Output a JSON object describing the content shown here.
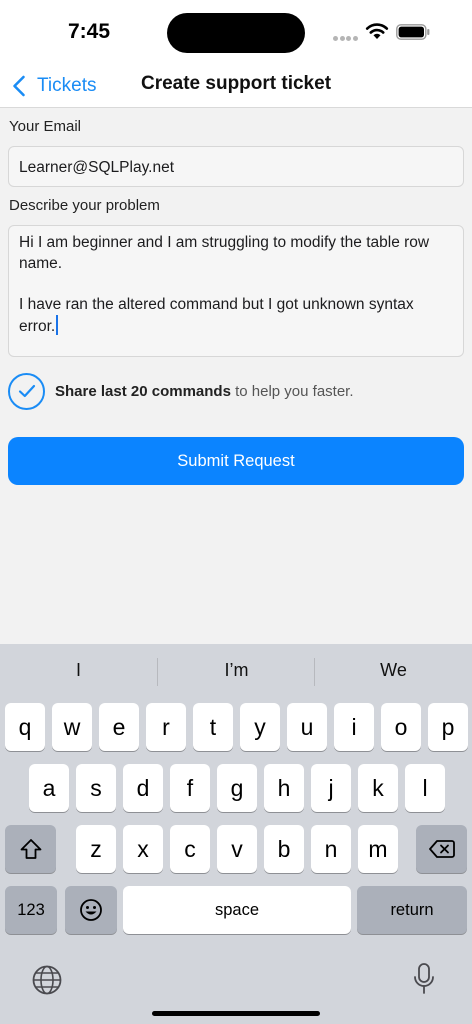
{
  "status_bar": {
    "time": "7:45"
  },
  "nav": {
    "back_label": "Tickets",
    "title": "Create support ticket"
  },
  "form": {
    "email_label": "Your Email",
    "email_value": "Learner@SQLPlay.net",
    "problem_label": "Describe your problem",
    "problem_paragraph_1": "Hi I am beginner and I am struggling to modify the table row name.",
    "problem_paragraph_2": "I have ran the altered command but I got unknown syntax error.",
    "share_bold": "Share last 20 commands",
    "share_rest": " to help you faster.",
    "share_checked": true,
    "submit_label": "Submit Request"
  },
  "keyboard": {
    "suggestions": [
      "I",
      "I’m",
      "We"
    ],
    "row1": [
      "q",
      "w",
      "e",
      "r",
      "t",
      "y",
      "u",
      "i",
      "o",
      "p"
    ],
    "row2": [
      "a",
      "s",
      "d",
      "f",
      "g",
      "h",
      "j",
      "k",
      "l"
    ],
    "row3": [
      "z",
      "x",
      "c",
      "v",
      "b",
      "n",
      "m"
    ],
    "numbers_label": "123",
    "space_label": "space",
    "return_label": "return"
  },
  "colors": {
    "accent": "#0b84ff",
    "keyboard_bg": "#d2d5db"
  }
}
